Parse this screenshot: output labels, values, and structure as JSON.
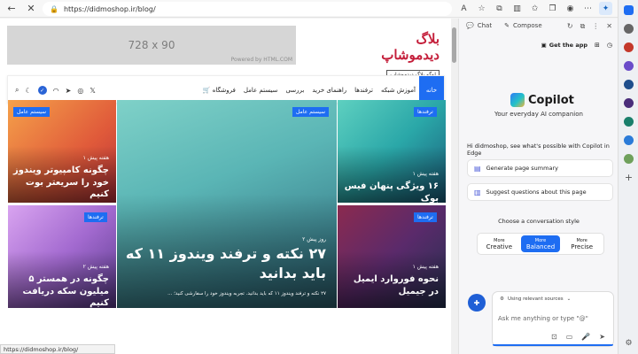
{
  "browser": {
    "url": "https://didmoshop.ir/blog/",
    "status_url": "https://didmoshop.ir/blog/"
  },
  "page": {
    "ad": {
      "size": "728 x 90",
      "credit": "Powered by HTML.COM"
    },
    "logo": {
      "title": "بلاگ دیدموشاپ",
      "subtitle": "لوگو بلاگ دیدموشاپ"
    },
    "nav": {
      "home": "خانه",
      "links": [
        "آموزش شبکه",
        "ترفندها",
        "راهنمای خرید",
        "بررسی",
        "سیستم عامل"
      ],
      "shop": "فروشگاه"
    },
    "cards": [
      {
        "badge": "سیستم عامل",
        "meta": "۱ هفته پیش",
        "title": "چگونه کامپیوتر ویندوز خود را سریعتر بوت کنیم"
      },
      {
        "badge": "ترفندها",
        "meta": "۲ هفته پیش",
        "title": "چگونه در همستر ۵ میلیون سکه دریافت کنیم"
      },
      {
        "badge": "سیستم عامل",
        "meta": "۲ روز پیش",
        "title": "۲۷ نکته و ترفند ویندوز ۱۱ که باید بدانید",
        "excerpt": "۲۷ نکته و ترفند ویندوز ۱۱ که باید بدانید. تجربه ویندوز خود را سفارشی کنید؛ ..."
      },
      {
        "badge": "ترفندها",
        "meta": "۱ هفته پیش",
        "title": "۱۶ ویژگی پنهان فیس بوک"
      },
      {
        "badge": "ترفندها",
        "meta": "۱ هفته پیش",
        "title": "نحوه فوروارد ایمیل در جیمیل"
      }
    ]
  },
  "copilot": {
    "tabs": [
      "Chat",
      "Compose"
    ],
    "get_app": "Get the app",
    "name": "Copilot",
    "tagline": "Your everyday AI companion",
    "intro": "Hi didmoshop, see what's possible with Copilot in Edge",
    "suggestions": [
      "Generate page summary",
      "Suggest questions about this page"
    ],
    "style_title": "Choose a conversation style",
    "styles": [
      {
        "small": "More",
        "big": "Creative"
      },
      {
        "small": "More",
        "big": "Balanced"
      },
      {
        "small": "More",
        "big": "Precise"
      }
    ],
    "sources": "Using relevant sources",
    "placeholder": "Ask me anything or type \"@\""
  },
  "colors": {
    "accent": "#1e6df2",
    "nav_active": "#e02020",
    "logo": "#c41e3a"
  }
}
